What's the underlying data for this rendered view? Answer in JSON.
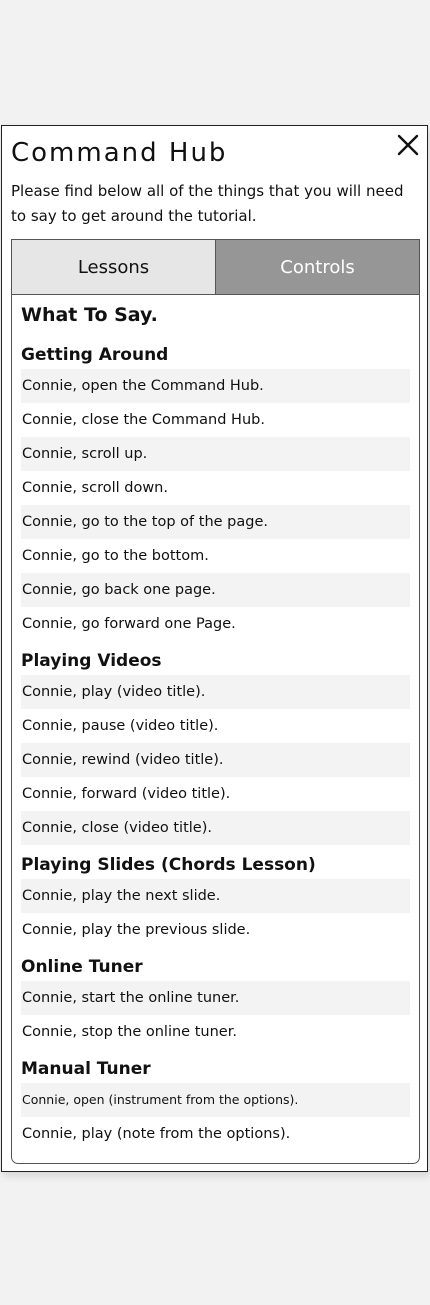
{
  "panel": {
    "title": "Command Hub",
    "intro": "Please find below all of the things that you will need to say to get around the tutorial.",
    "close_icon": "close-icon"
  },
  "tabs": [
    {
      "label": "Lessons",
      "active": false
    },
    {
      "label": "Controls",
      "active": true
    }
  ],
  "content": {
    "heading": "What To Say.",
    "sections": [
      {
        "title": "Getting Around",
        "commands": [
          "Connie, open the Command Hub.",
          "Connie, close the Command Hub.",
          "Connie, scroll up.",
          "Connie, scroll down.",
          "Connie, go to the top of the page.",
          "Connie, go to the bottom.",
          "Connie, go back one page.",
          "Connie, go forward one Page."
        ]
      },
      {
        "title": "Playing Videos",
        "commands": [
          "Connie, play (video title).",
          "Connie, pause (video title).",
          "Connie, rewind (video title).",
          "Connie, forward (video title).",
          "Connie, close (video title)."
        ]
      },
      {
        "title": "Playing Slides (Chords Lesson)",
        "commands": [
          "Connie, play the next slide.",
          "Connie, play the previous slide."
        ]
      },
      {
        "title": "Online Tuner",
        "commands": [
          "Connie, start the online tuner.",
          "Connie, stop the online tuner."
        ]
      },
      {
        "title": "Manual Tuner",
        "commands": [
          "Connie, open (instrument from the options).",
          "Connie, play (note from the options)."
        ]
      }
    ]
  },
  "colors": {
    "tab_active_bg": "#969696",
    "tab_inactive_bg": "#e6e6e6",
    "row_shade": "#f3f3f3"
  }
}
